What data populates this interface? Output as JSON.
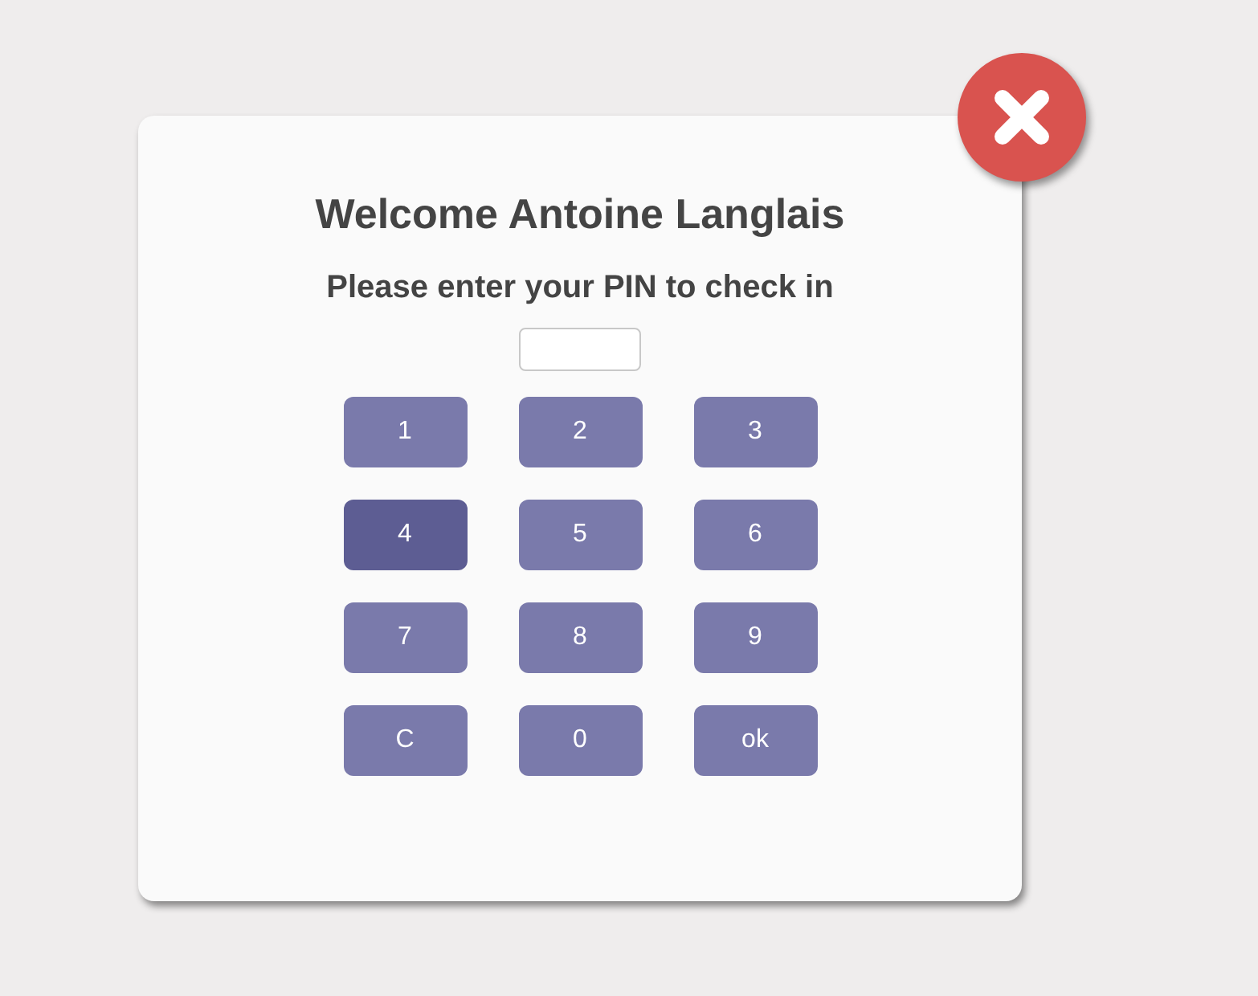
{
  "dialog": {
    "title": "Welcome Antoine Langlais",
    "prompt": "Please enter your PIN to check in"
  },
  "keypad": [
    {
      "label": "1",
      "pressed": false
    },
    {
      "label": "2",
      "pressed": false
    },
    {
      "label": "3",
      "pressed": false
    },
    {
      "label": "4",
      "pressed": true
    },
    {
      "label": "5",
      "pressed": false
    },
    {
      "label": "6",
      "pressed": false
    },
    {
      "label": "7",
      "pressed": false
    },
    {
      "label": "8",
      "pressed": false
    },
    {
      "label": "9",
      "pressed": false
    },
    {
      "label": "C",
      "pressed": false
    },
    {
      "label": "0",
      "pressed": false
    },
    {
      "label": "ok",
      "pressed": false
    }
  ]
}
